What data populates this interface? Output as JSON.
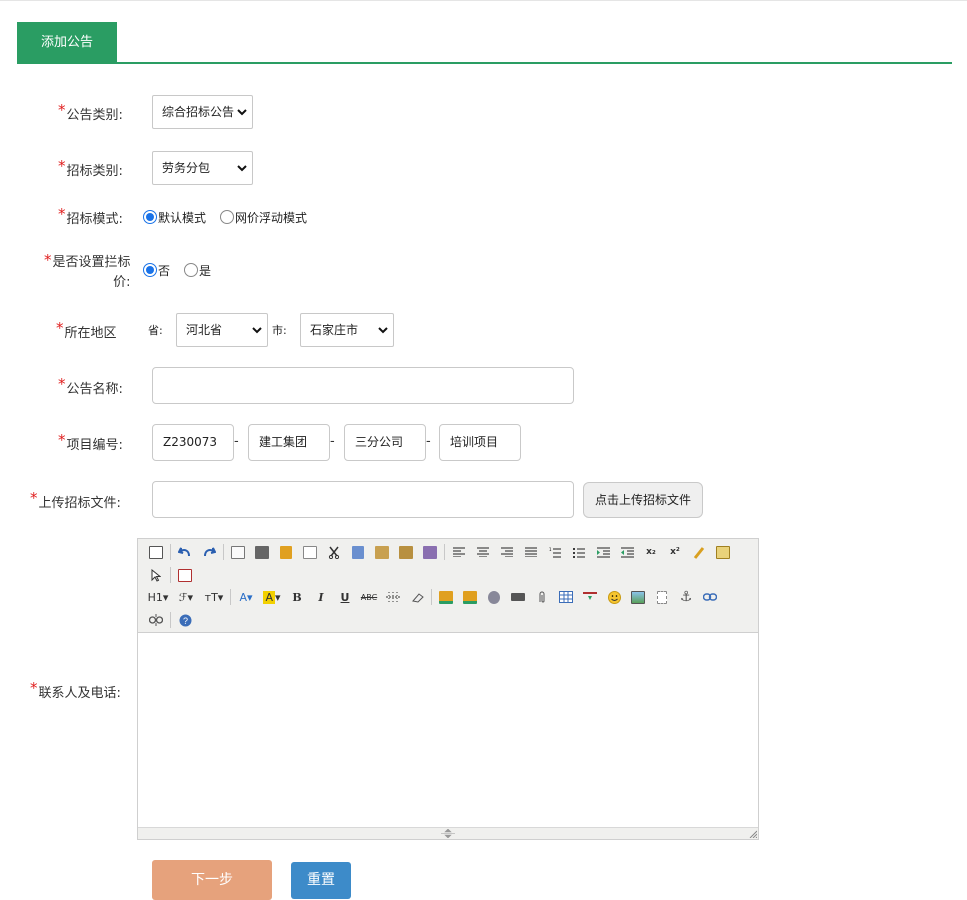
{
  "tab": {
    "label": "添加公告"
  },
  "form": {
    "announcement_category": {
      "label": "公告类别:",
      "value": "综合招标公告"
    },
    "bid_category": {
      "label": "招标类别:",
      "value": "劳务分包"
    },
    "bid_mode": {
      "label": "招标模式:",
      "options": [
        "默认模式",
        "网价浮动模式"
      ],
      "selected": "默认模式"
    },
    "price_cap": {
      "label_line1": "是否设置拦标",
      "label_line2": "价:",
      "options": [
        "否",
        "是"
      ],
      "selected": "否"
    },
    "region": {
      "label": "所在地区",
      "province_label": "省:",
      "province": "河北省",
      "city_label": "市:",
      "city": "石家庄市"
    },
    "announcement_name": {
      "label": "公告名称:",
      "value": ""
    },
    "project_number": {
      "label": "项目编号:",
      "parts": [
        "Z230073",
        "建工集团",
        "三分公司",
        "培训项目"
      ],
      "separator": "-"
    },
    "upload": {
      "label": "上传招标文件:",
      "value": "",
      "button": "点击上传招标文件"
    },
    "contact": {
      "label": "联系人及电话:"
    }
  },
  "buttons": {
    "next": "下一步",
    "reset": "重置"
  },
  "required_mark": "*",
  "colors": {
    "accent": "#2a9d63",
    "required": "#e02020",
    "next_button": "#e6a27c",
    "reset_button": "#3d8bc9"
  }
}
